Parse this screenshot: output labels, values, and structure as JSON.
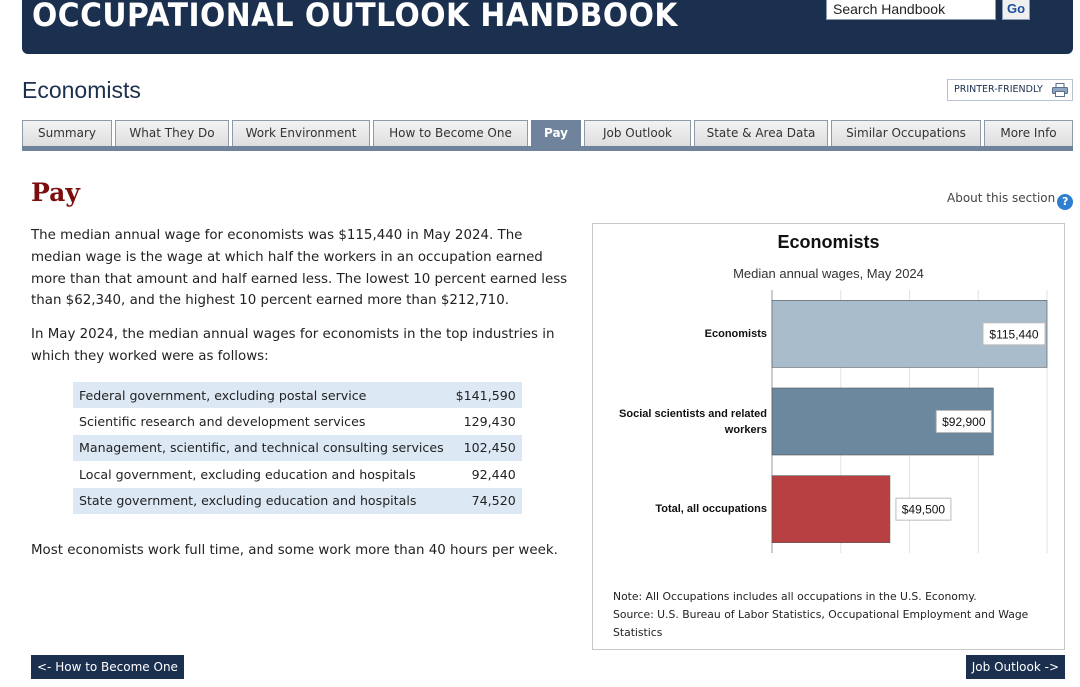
{
  "header": {
    "title": "OCCUPATIONAL OUTLOOK HANDBOOK",
    "search_placeholder": "Search Handbook",
    "go_label": "Go"
  },
  "occupation": {
    "title": "Economists",
    "printer_label": "PRINTER-FRIENDLY"
  },
  "tabs": [
    {
      "label": "Summary",
      "active": false
    },
    {
      "label": "What They Do",
      "active": false
    },
    {
      "label": "Work Environment",
      "active": false
    },
    {
      "label": "How to Become One",
      "active": false
    },
    {
      "label": "Pay",
      "active": true
    },
    {
      "label": "Job Outlook",
      "active": false
    },
    {
      "label": "State & Area Data",
      "active": false
    },
    {
      "label": "Similar Occupations",
      "active": false
    },
    {
      "label": "More Info",
      "active": false
    }
  ],
  "section": {
    "title": "Pay",
    "about_label": "About this section",
    "paragraph1": "The median annual wage for economists was $115,440 in May 2024. The median wage is the wage at which half the workers in an occupation earned more than that amount and half earned less. The lowest 10 percent earned less than $62,340, and the highest 10 percent earned more than $212,710.",
    "paragraph2": "In May 2024, the median annual wages for economists in the top industries in which they worked were as follows:",
    "paragraph3": "Most economists work full time, and some work more than 40 hours per week."
  },
  "industries": [
    {
      "name": "Federal government, excluding postal service",
      "wage": "$141,590"
    },
    {
      "name": "Scientific research and development services",
      "wage": "129,430"
    },
    {
      "name": "Management, scientific, and technical consulting services",
      "wage": "102,450"
    },
    {
      "name": "Local government, excluding education and hospitals",
      "wage": "92,440"
    },
    {
      "name": "State government, excluding education and hospitals",
      "wage": "74,520"
    }
  ],
  "chart": {
    "note": "Note: All Occupations includes all occupations in the U.S. Economy.",
    "source": "Source: U.S. Bureau of Labor Statistics, Occupational Employment and Wage Statistics"
  },
  "chart_data": {
    "type": "bar",
    "orientation": "horizontal",
    "title": "Economists",
    "subtitle": "Median annual wages, May 2024",
    "categories": [
      "Economists",
      "Social scientists and related workers",
      "Total, all occupations"
    ],
    "values": [
      115440,
      92900,
      49500
    ],
    "data_labels": [
      "$115,440",
      "$92,900",
      "$49,500"
    ],
    "colors": [
      "#a9bccb",
      "#6b889f",
      "#b84043"
    ],
    "xlim": [
      0,
      115440
    ],
    "grid": true
  },
  "nav": {
    "prev_label": "<- How to Become One",
    "next_label": "Job Outlook ->"
  },
  "colors": {
    "banner": "#1b2f4f",
    "tab_active": "#6f849c",
    "section_title": "#7b0d0d",
    "table_stripe": "#dde8f5"
  }
}
